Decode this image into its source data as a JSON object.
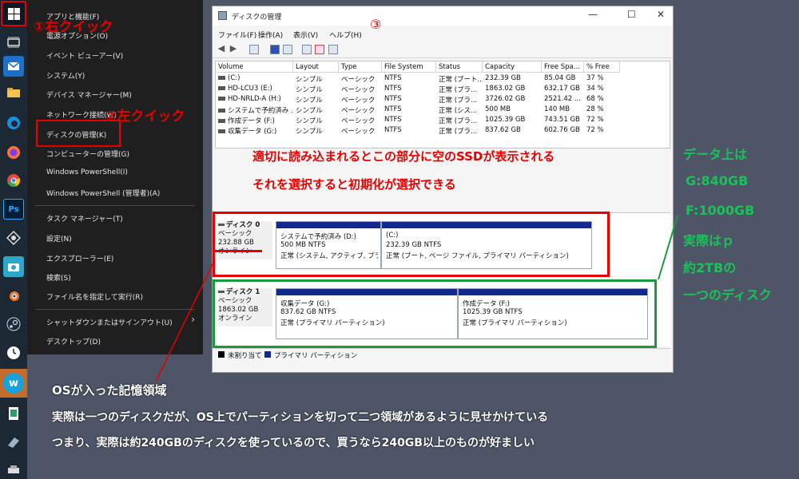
{
  "taskbar": {
    "icons": [
      "windows-start",
      "task-view",
      "mail",
      "file-explorer",
      "edge",
      "firefox",
      "chrome",
      "photoshop",
      "cpu-tool",
      "camera-app",
      "blender",
      "steam",
      "clock-app",
      "wp-app",
      "spreadsheet",
      "usb-app",
      "drive-app"
    ],
    "ps_label": "Ps",
    "w_label": "w"
  },
  "start_menu": {
    "items": [
      {
        "label": "アプリと機能(F)"
      },
      {
        "label": "電源オプション(O)"
      },
      {
        "label": "イベント ビューアー(V)"
      },
      {
        "label": "システム(Y)"
      },
      {
        "label": "デバイス マネージャー(M)"
      },
      {
        "label": "ネットワーク接続(W)"
      },
      {
        "label": "ディスクの管理(K)"
      },
      {
        "label": "コンピューターの管理(G)"
      },
      {
        "label": "Windows PowerShell(I)"
      },
      {
        "label": "Windows PowerShell (管理者)(A)"
      },
      {
        "label": "タスク マネージャー(T)"
      },
      {
        "label": "設定(N)"
      },
      {
        "label": "エクスプローラー(E)"
      },
      {
        "label": "検索(S)"
      },
      {
        "label": "ファイル名を指定して実行(R)"
      },
      {
        "label": "シャットダウンまたはサインアウト(U)"
      },
      {
        "label": "デスクトップ(D)"
      }
    ],
    "submenu_arrow": "›"
  },
  "window": {
    "title": "ディスクの管理",
    "step_number": "③",
    "controls": {
      "minimize": "—",
      "maximize": "☐",
      "close": "✕"
    },
    "menu": [
      "ファイル(F)",
      "操作(A)",
      "表示(V)",
      "ヘルプ(H)"
    ]
  },
  "volume_table": {
    "headers": [
      "Volume",
      "Layout",
      "Type",
      "File System",
      "Status",
      "Capacity",
      "Free Spa...",
      "% Free"
    ],
    "rows": [
      [
        "(C:)",
        "シンプル",
        "ベーシック",
        "NTFS",
        "正常 (ブート...",
        "232.39 GB",
        "85.04 GB",
        "37 %"
      ],
      [
        "HD-LCU3 (E:)",
        "シンプル",
        "ベーシック",
        "NTFS",
        "正常 (プラ...",
        "1863.02 GB",
        "632.17 GB",
        "34 %"
      ],
      [
        "HD-NRLD-A (H:)",
        "シンプル",
        "ベーシック",
        "NTFS",
        "正常 (プラ...",
        "3726.02 GB",
        "2521.42 ...",
        "68 %"
      ],
      [
        "システムで予約済み ...",
        "シンプル",
        "ベーシック",
        "NTFS",
        "正常 (シス...",
        "500 MB",
        "140 MB",
        "28 %"
      ],
      [
        "作成データ (F:)",
        "シンプル",
        "ベーシック",
        "NTFS",
        "正常 (プラ...",
        "1025.39 GB",
        "743.51 GB",
        "72 %"
      ],
      [
        "収集データ (G:)",
        "シンプル",
        "ベーシック",
        "NTFS",
        "正常 (プラ...",
        "837.62 GB",
        "602.76 GB",
        "72 %"
      ]
    ]
  },
  "disks": [
    {
      "name": "ディスク 0",
      "type": "ベーシック",
      "size": "232.88 GB",
      "status": "オンライン",
      "partitions": [
        {
          "name": "システムで予約済み (D:)",
          "size": "500 MB NTFS",
          "status": "正常 (システム, アクティブ, プライマ"
        },
        {
          "name": "(C:)",
          "size": "232.39 GB NTFS",
          "status": "正常 (ブート, ページ ファイル, プライマリ パーティション)"
        }
      ]
    },
    {
      "name": "ディスク 1",
      "type": "ベーシック",
      "size": "1863.02 GB",
      "status": "オンライン",
      "partitions": [
        {
          "name": "収集データ (G:)",
          "size": "837.62 GB NTFS",
          "status": "正常 (プライマリ パーティション)"
        },
        {
          "name": "作成データ (F:)",
          "size": "1025.39 GB NTFS",
          "status": "正常 (プライマリ パーティション)"
        }
      ]
    }
  ],
  "legend": {
    "unallocated": "未割り当て",
    "primary": "プライマリ パーティション",
    "unallocated_color": "#000000",
    "primary_color": "#0f2a8c"
  },
  "annotations": {
    "step1": "①右クイック",
    "step2": "②左クイック",
    "ssd_line1": "適切に読み込まれるとこの部分に空のSSDが表示される",
    "ssd_line2": "それを選択すると初期化が選択できる",
    "green": [
      "データ上は",
      "G:840GB",
      "F:1000GB",
      "実際はｐ",
      "約2TBの",
      "一つのディスク"
    ],
    "os_title": "OSが入った記憶領域",
    "os_line1": "実際は一つのディスクだが、OS上でパーティションを切って二つ領域があるように見せかけている",
    "os_line2": "つまり、実際は約240GBのディスクを使っているので、買うなら240GB以上のものが好ましい",
    "red_color": "#e60000",
    "green_color": "#1ac25a"
  }
}
